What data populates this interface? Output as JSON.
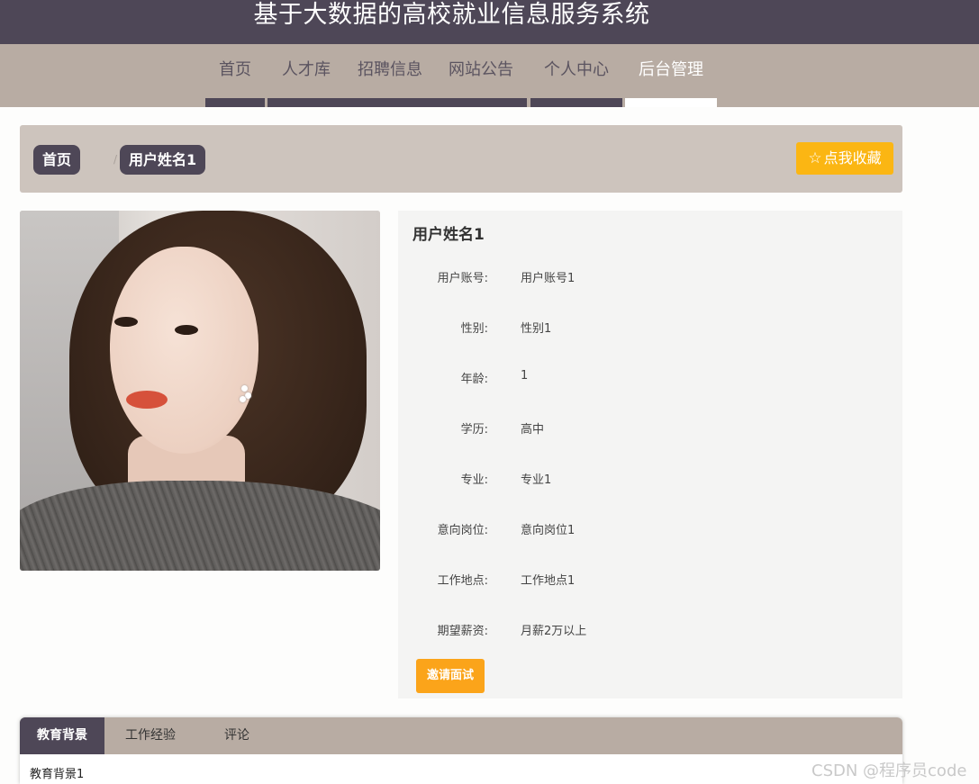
{
  "header": {
    "site_title": "基于大数据的高校就业信息服务系统"
  },
  "nav": {
    "items": [
      {
        "label": "首页",
        "active": false
      },
      {
        "label": "人才库",
        "active": false
      },
      {
        "label": "招聘信息",
        "active": false
      },
      {
        "label": "网站公告",
        "active": false
      },
      {
        "label": "个人中心",
        "active": false
      },
      {
        "label": "后台管理",
        "active": true
      }
    ]
  },
  "breadcrumb": {
    "home": "首页",
    "separator": "/",
    "current": "用户姓名1"
  },
  "favorite_button": {
    "icon": "star-outline-icon",
    "label": "点我收藏"
  },
  "profile": {
    "name": "用户姓名1",
    "fields": [
      {
        "label": "用户账号:",
        "value": "用户账号1"
      },
      {
        "label": "性别:",
        "value": "性别1"
      },
      {
        "label": "年龄:",
        "value": "1"
      },
      {
        "label": "学历:",
        "value": "高中"
      },
      {
        "label": "专业:",
        "value": "专业1"
      },
      {
        "label": "意向岗位:",
        "value": "意向岗位1"
      },
      {
        "label": "工作地点:",
        "value": "工作地点1"
      },
      {
        "label": "期望薪资:",
        "value": "月薪2万以上"
      }
    ],
    "invite_button": "邀请面试"
  },
  "tabs": {
    "items": [
      {
        "label": "教育背景",
        "active": true
      },
      {
        "label": "工作经验",
        "active": false
      },
      {
        "label": "评论",
        "active": false
      }
    ],
    "content": "教育背景1"
  },
  "watermark": "CSDN @程序员code",
  "colors": {
    "header_bg": "#4e4757",
    "nav_bg": "#b8aca3",
    "breadcrumb_bg": "#cdc4bd",
    "favorite_button": "#fbb613",
    "invite_button": "#fba41a",
    "info_panel_bg": "#f4f4f3"
  }
}
